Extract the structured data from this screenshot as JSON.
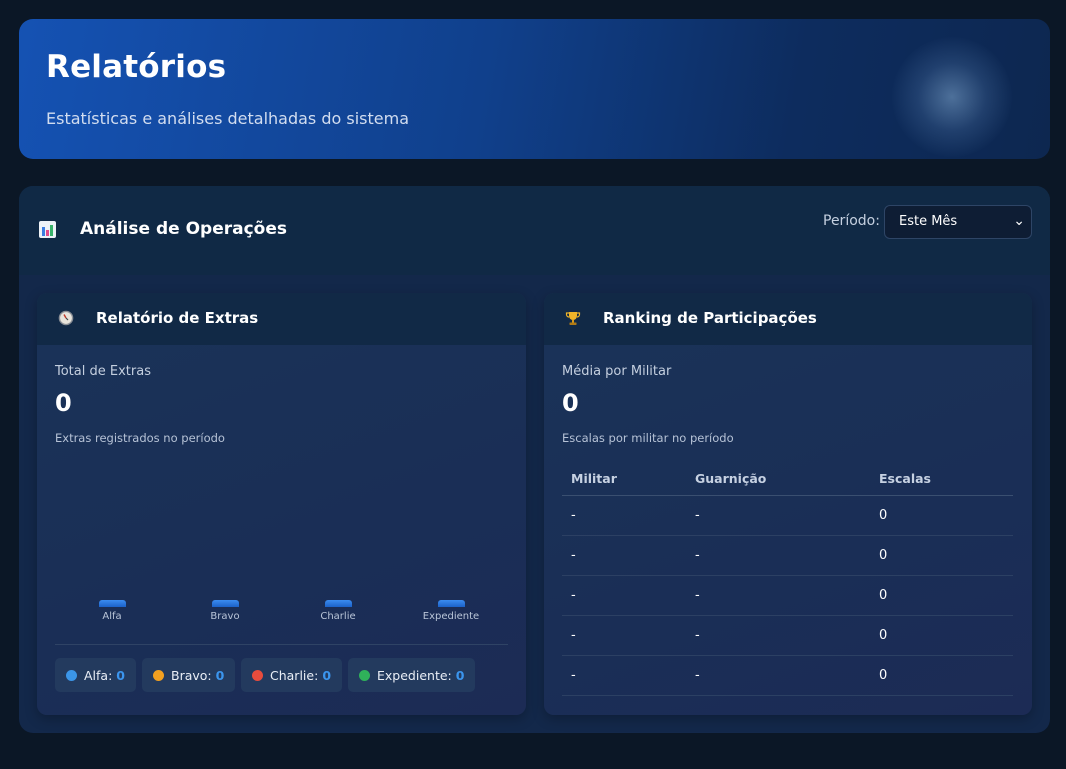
{
  "header": {
    "title": "Relatórios",
    "subtitle": "Estatísticas e análises detalhadas do sistema"
  },
  "operations": {
    "title": "Análise de Operações",
    "period_label": "Período:",
    "period_selected": "Este Mês"
  },
  "extras": {
    "title": "Relatório de Extras",
    "stat_label": "Total de Extras",
    "stat_value": "0",
    "stat_sub": "Extras registrados no período",
    "bars": [
      {
        "label": "Alfa",
        "value": 0
      },
      {
        "label": "Bravo",
        "value": 0
      },
      {
        "label": "Charlie",
        "value": 0
      },
      {
        "label": "Expediente",
        "value": 0
      }
    ],
    "legend": [
      {
        "name": "Alfa:",
        "value": "0",
        "color": "#3b95e8"
      },
      {
        "name": "Bravo:",
        "value": "0",
        "color": "#f2a020"
      },
      {
        "name": "Charlie:",
        "value": "0",
        "color": "#e84c3d"
      },
      {
        "name": "Expediente:",
        "value": "0",
        "color": "#2fb25a"
      }
    ]
  },
  "ranking": {
    "title": "Ranking de Participações",
    "stat_label": "Média por Militar",
    "stat_value": "0",
    "stat_sub": "Escalas por militar no período",
    "columns": [
      "Militar",
      "Guarnição",
      "Escalas"
    ],
    "rows": [
      [
        "-",
        "-",
        "0"
      ],
      [
        "-",
        "-",
        "0"
      ],
      [
        "-",
        "-",
        "0"
      ],
      [
        "-",
        "-",
        "0"
      ],
      [
        "-",
        "-",
        "0"
      ]
    ]
  }
}
